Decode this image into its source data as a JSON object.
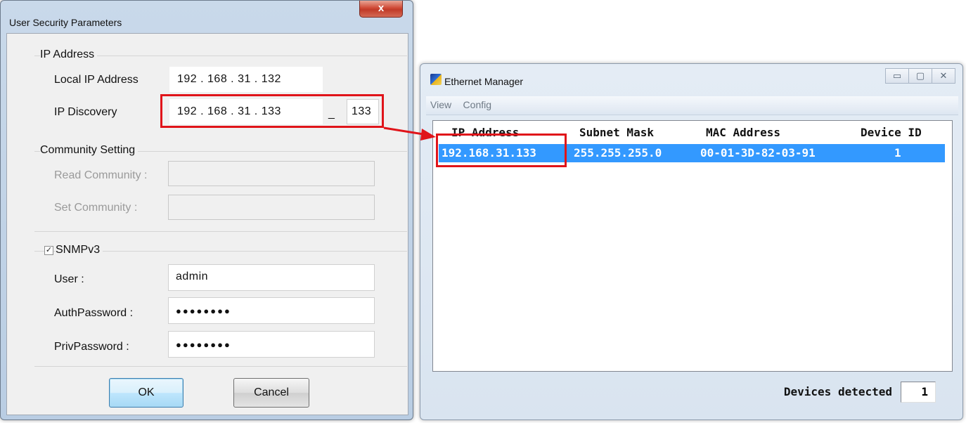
{
  "security_dialog": {
    "title": "User Security Parameters",
    "close_label": "x",
    "ip_group": {
      "label": "IP Address",
      "local_ip_label": "Local IP Address",
      "local_ip_value": "192 . 168 .  31  . 132",
      "discovery_label": "IP Discovery",
      "discovery_start": "192 . 168 .  31  . 133",
      "discovery_sep": "_",
      "discovery_end": "133"
    },
    "community_group": {
      "label": "Community Setting",
      "read_label": "Read Community :",
      "read_value": "",
      "set_label": "Set Community :",
      "set_value": ""
    },
    "snmp_group": {
      "label": "SNMPv3",
      "checked_mark": "✓",
      "user_label": "User :",
      "user_value": "admin",
      "auth_label": "AuthPassword :",
      "auth_value": "●●●●●●●●",
      "priv_label": "PrivPassword :",
      "priv_value": "●●●●●●●●"
    },
    "buttons": {
      "ok": "OK",
      "cancel": "Cancel"
    }
  },
  "ethernet_manager": {
    "title": "Ethernet Manager",
    "controls": {
      "minimize": "▭",
      "maximize": "▢",
      "close": "✕"
    },
    "menu": [
      "View",
      "Config"
    ],
    "columns": [
      "IP Address",
      "Subnet Mask",
      "MAC Address",
      "Device ID"
    ],
    "rows": [
      {
        "ip": "192.168.31.133",
        "mask": "255.255.255.0",
        "mac": "00-01-3D-82-03-91",
        "device_id": "1"
      }
    ],
    "status_label": "Devices detected",
    "status_count": "1"
  },
  "colors": {
    "highlight": "#e0141a",
    "selection": "#3399ff"
  }
}
